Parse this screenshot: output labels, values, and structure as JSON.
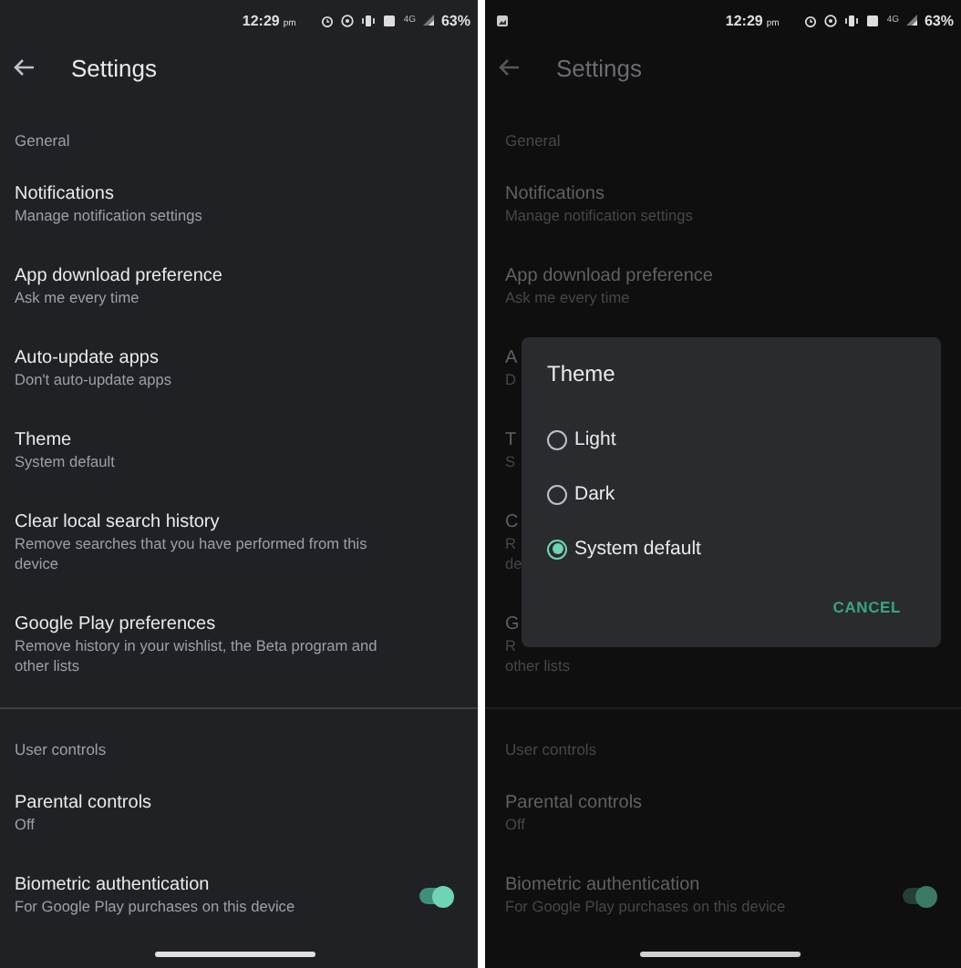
{
  "screens": [
    {
      "dimmed": false,
      "status_bar": {
        "notification_icon": false,
        "time": "12:29",
        "time_suffix": "pm",
        "network": "4G",
        "battery": "63%"
      },
      "header": {
        "title": "Settings"
      },
      "sections": [
        {
          "title": "General",
          "items": [
            {
              "kind": "row",
              "title": "Notifications",
              "subtitle": "Manage notification settings"
            },
            {
              "kind": "row",
              "title": "App download preference",
              "subtitle": "Ask me every time"
            },
            {
              "kind": "row",
              "title": "Auto-update apps",
              "subtitle": "Don't auto-update apps"
            },
            {
              "kind": "row",
              "title": "Theme",
              "subtitle": "System default"
            },
            {
              "kind": "row",
              "title": "Clear local search history",
              "subtitle": "Remove searches that you have performed from this device"
            },
            {
              "kind": "row",
              "title": "Google Play preferences",
              "subtitle": "Remove history in your wishlist, the Beta program and other lists"
            }
          ]
        },
        {
          "title": "User controls",
          "items": [
            {
              "kind": "row",
              "title": "Parental controls",
              "subtitle": "Off"
            },
            {
              "kind": "toggle",
              "title": "Biometric authentication",
              "subtitle": "For Google Play purchases on this device",
              "on": true
            }
          ]
        }
      ]
    },
    {
      "dimmed": true,
      "status_bar": {
        "notification_icon": true,
        "time": "12:29",
        "time_suffix": "pm",
        "network": "4G",
        "battery": "63%"
      },
      "header": {
        "title": "Settings"
      },
      "sections": [
        {
          "title": "General",
          "items": [
            {
              "kind": "row",
              "title": "Notifications",
              "subtitle": "Manage notification settings"
            },
            {
              "kind": "row",
              "title": "App download preference",
              "subtitle": "Ask me every time"
            },
            {
              "kind": "covered",
              "fragments": [
                "A",
                "D"
              ]
            },
            {
              "kind": "covered",
              "fragments": [
                "T",
                "S"
              ]
            },
            {
              "kind": "covered",
              "fragments": [
                "C",
                "R",
                "de"
              ]
            },
            {
              "kind": "covered",
              "fragments": [
                "G",
                "R",
                "other lists"
              ]
            }
          ]
        },
        {
          "title": "User controls",
          "items": [
            {
              "kind": "row",
              "title": "Parental controls",
              "subtitle": "Off"
            },
            {
              "kind": "toggle",
              "title": "Biometric authentication",
              "subtitle": "For Google Play purchases on this device",
              "on": true
            }
          ]
        }
      ],
      "dialog": {
        "title": "Theme",
        "options": [
          {
            "label": "Light",
            "selected": false
          },
          {
            "label": "Dark",
            "selected": false
          },
          {
            "label": "System default",
            "selected": true
          }
        ],
        "button": "CANCEL"
      }
    }
  ]
}
